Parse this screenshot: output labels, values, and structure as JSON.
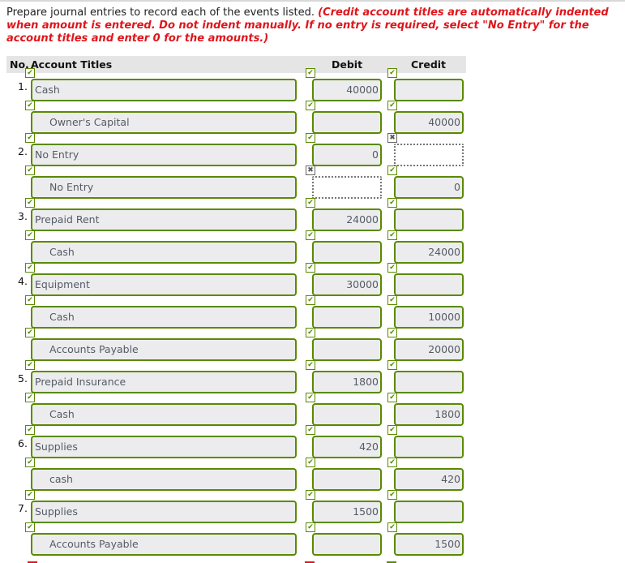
{
  "instructions": {
    "plain": "Prepare journal entries to record each of the events listed.",
    "emphasis": "(Credit account titles are automatically indented when amount is entered. Do not indent manually. If no entry is required, select \"No Entry\" for the account titles and enter 0 for the amounts.)"
  },
  "table": {
    "headers": {
      "no": "No.",
      "title": "Account Titles",
      "debit": "Debit",
      "credit": "Credit"
    },
    "rows": [
      {
        "no": "1.",
        "title": "Cash",
        "indent": false,
        "debit": "40000",
        "credit": "",
        "title_status": "correct",
        "debit_status": "correct",
        "credit_status": "correct"
      },
      {
        "no": "",
        "title": "Owner's Capital",
        "indent": true,
        "debit": "",
        "credit": "40000",
        "title_status": "correct",
        "debit_status": "correct",
        "credit_status": "correct"
      },
      {
        "no": "2.",
        "title": "No Entry",
        "indent": false,
        "debit": "0",
        "credit": "",
        "title_status": "correct",
        "debit_status": "correct",
        "credit_status": "incorrect"
      },
      {
        "no": "",
        "title": "No Entry",
        "indent": true,
        "debit": "",
        "credit": "0",
        "title_status": "correct",
        "debit_status": "incorrect",
        "credit_status": "correct"
      },
      {
        "no": "3.",
        "title": "Prepaid Rent",
        "indent": false,
        "debit": "24000",
        "credit": "",
        "title_status": "correct",
        "debit_status": "correct",
        "credit_status": "correct"
      },
      {
        "no": "",
        "title": "Cash",
        "indent": true,
        "debit": "",
        "credit": "24000",
        "title_status": "correct",
        "debit_status": "correct",
        "credit_status": "correct"
      },
      {
        "no": "4.",
        "title": "Equipment",
        "indent": false,
        "debit": "30000",
        "credit": "",
        "title_status": "correct",
        "debit_status": "correct",
        "credit_status": "correct"
      },
      {
        "no": "",
        "title": "Cash",
        "indent": true,
        "debit": "",
        "credit": "10000",
        "title_status": "correct",
        "debit_status": "correct",
        "credit_status": "correct"
      },
      {
        "no": "",
        "title": "Accounts Payable",
        "indent": true,
        "debit": "",
        "credit": "20000",
        "title_status": "correct",
        "debit_status": "correct",
        "credit_status": "correct"
      },
      {
        "no": "5.",
        "title": "Prepaid Insurance",
        "indent": false,
        "debit": "1800",
        "credit": "",
        "title_status": "correct",
        "debit_status": "correct",
        "credit_status": "correct"
      },
      {
        "no": "",
        "title": "Cash",
        "indent": true,
        "debit": "",
        "credit": "1800",
        "title_status": "correct",
        "debit_status": "correct",
        "credit_status": "correct"
      },
      {
        "no": "6.",
        "title": "Supplies",
        "indent": false,
        "debit": "420",
        "credit": "",
        "title_status": "correct",
        "debit_status": "correct",
        "credit_status": "correct"
      },
      {
        "no": "",
        "title": "cash",
        "indent": true,
        "debit": "",
        "credit": "420",
        "title_status": "correct",
        "debit_status": "correct",
        "credit_status": "correct"
      },
      {
        "no": "7.",
        "title": "Supplies",
        "indent": false,
        "debit": "1500",
        "credit": "",
        "title_status": "correct",
        "debit_status": "correct",
        "credit_status": "correct"
      },
      {
        "no": "",
        "title": "Accounts Payable",
        "indent": true,
        "debit": "",
        "credit": "1500",
        "title_status": "correct",
        "debit_status": "correct",
        "credit_status": "correct"
      }
    ]
  },
  "icons": {
    "correct": "check-mark",
    "incorrect": "x-mark"
  },
  "colors": {
    "correct_border": "#5a8a00",
    "incorrect_border": "#777777",
    "instruction_red": "#e0151b",
    "field_bg": "#ececee",
    "header_bg": "#e5e5e5"
  }
}
